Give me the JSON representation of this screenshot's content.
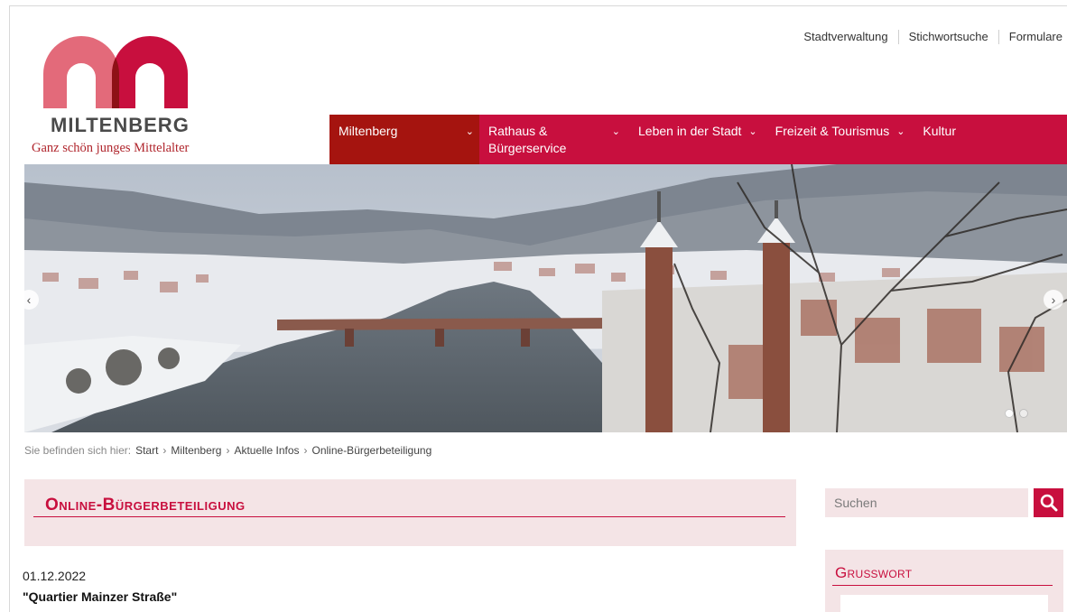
{
  "utility_nav": [
    "Stadtverwaltung",
    "Stichwortsuche",
    "Formulare"
  ],
  "logo": {
    "wordmark": "MILTENBERG",
    "tagline": "Ganz schön junges Mittelalter"
  },
  "main_nav": [
    {
      "label": "Miltenberg",
      "active": true
    },
    {
      "label": "Rathaus & Bürgerservice",
      "active": false
    },
    {
      "label": "Leben in der Stadt",
      "active": false
    },
    {
      "label": "Freizeit & Tourismus",
      "active": false
    },
    {
      "label": "Kultur",
      "active": false
    }
  ],
  "breadcrumb": {
    "prefix": "Sie befinden sich hier:",
    "items": [
      "Start",
      "Miltenberg",
      "Aktuelle Infos",
      "Online-Bürgerbeteiligung"
    ],
    "separator": "›"
  },
  "content": {
    "title": "Online-Bürgerbeteiligung",
    "date": "01.12.2022",
    "post_title": "\"Quartier Mainzer Straße\""
  },
  "search": {
    "placeholder": "Suchen",
    "icon": "search-icon"
  },
  "sidebar": {
    "title": "Grußwort"
  },
  "colors": {
    "brand_red": "#c80f3e",
    "active_nav": "#a5140f",
    "box_bg": "#f4e4e6"
  },
  "slider": {
    "prev_icon": "chevron-left-icon",
    "next_icon": "chevron-right-icon",
    "slide_count": 2,
    "active_slide": 1
  }
}
